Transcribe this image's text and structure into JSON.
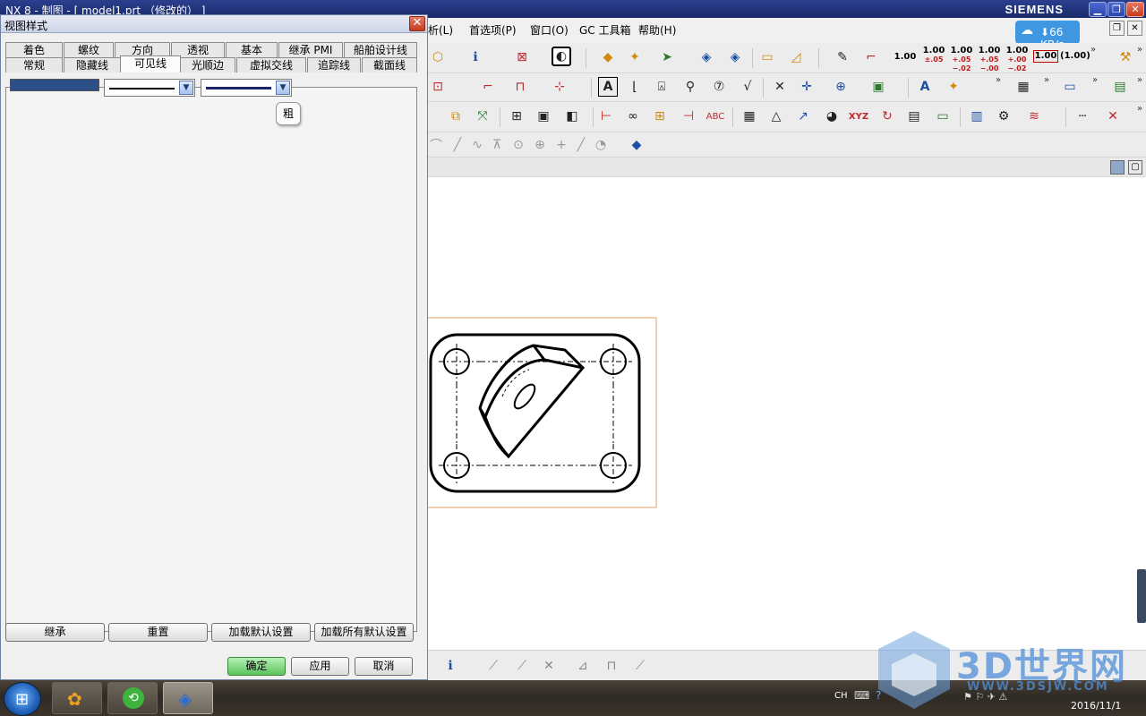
{
  "app": {
    "title": "NX 8 - 制图 - [ model1.prt （修改的） ]",
    "brand": "SIEMENS"
  },
  "menubar": {
    "items": [
      "析(L)",
      "首选项(P)",
      "窗口(O)",
      "GC 工具箱",
      "帮助(H)"
    ]
  },
  "network": {
    "speed": "66 KB/s"
  },
  "toolbar": {
    "dims": [
      {
        "main": "1.00",
        "sub": ""
      },
      {
        "main": "1.00",
        "sub": "±.05"
      },
      {
        "main": "1.00",
        "sub": "+.05 −.02"
      },
      {
        "main": "1.00",
        "sub": "+.05 −.00"
      },
      {
        "main": "1.00",
        "sub": "+.00 −.02"
      },
      {
        "main": "1.00",
        "sub": ""
      },
      {
        "main": "(1.00)",
        "sub": ""
      }
    ],
    "xyz_label": "XYZ",
    "abc_label": "ABC"
  },
  "dialog": {
    "title": "视图样式",
    "tabs_top": [
      "着色",
      "螺纹",
      "方向",
      "透视",
      "基本",
      "继承 PMI",
      "船舶设计线"
    ],
    "tabs_bottom": [
      "常规",
      "隐藏线",
      "可见线",
      "光顺边",
      "虚拟交线",
      "追踪线",
      "截面线"
    ],
    "active_tab": "可见线",
    "visible_line": {
      "color": "#2d4f88",
      "font": "solid",
      "width": "thick"
    },
    "tooltip": "粗",
    "buttons_row": [
      "继承",
      "重置",
      "加载默认设置",
      "加载所有默认设置"
    ],
    "ok_label": "确定",
    "apply_label": "应用",
    "cancel_label": "取消"
  },
  "taskbar": {
    "lang": "CH",
    "date": "2016/11/1"
  },
  "watermark": {
    "brand": "3D世界网",
    "url": "WWW.3DSJW.COM"
  }
}
